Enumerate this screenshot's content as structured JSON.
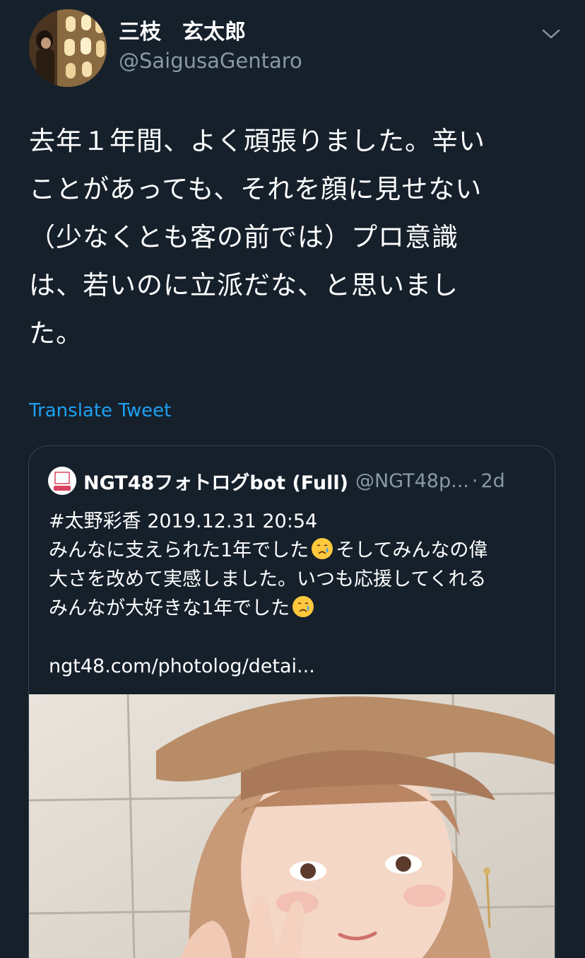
{
  "author": {
    "display_name": "三枝　玄太郎",
    "handle": "@SaigusaGentaro"
  },
  "tweet": {
    "text_lines": [
      "去年１年間、よく頑張りました。辛い",
      "ことがあっても、それを顔に見せない",
      "（少なくとも客の前では）プロ意識",
      "は、若いのに立派だな、と思いまし",
      "た。"
    ]
  },
  "translate_label": "Translate Tweet",
  "quote": {
    "display_name": "NGT48フォトログbot (Full)",
    "handle": "@NGT48p...",
    "separator": "·",
    "time": "2d",
    "line1": "#太野彩香 2019.12.31 20:54",
    "line2a": "みんなに支えられた1年でした",
    "line2b": "そしてみんなの偉",
    "line3": "大さを改めて実感しました。いつも応援してくれる",
    "line4": "みんなが大好きな1年でした",
    "link": "ngt48.com/photolog/detai..."
  },
  "icons": {
    "more": "chevron-down-icon",
    "emoji": "crying-face-icon"
  },
  "colors": {
    "background": "#15202b",
    "accent": "#1da1f2",
    "secondary_text": "#8899a6",
    "border": "#38444d"
  }
}
